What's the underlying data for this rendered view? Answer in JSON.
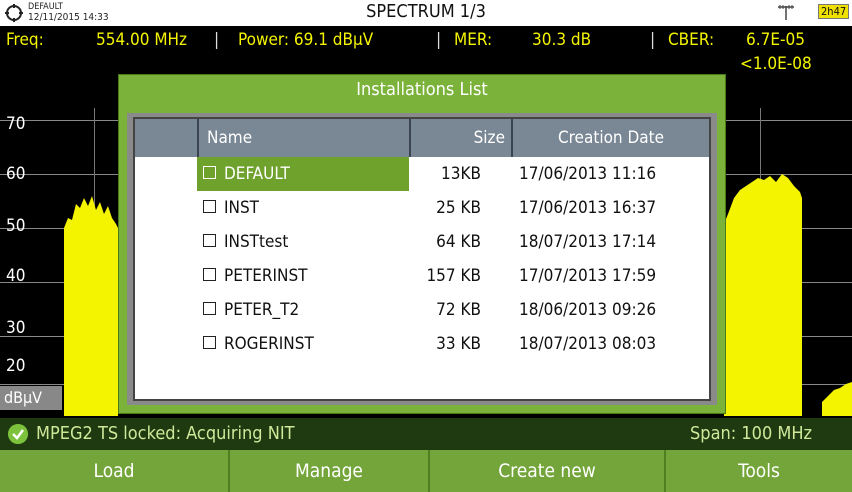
{
  "header": {
    "installation": "DEFAULT",
    "datetime": "12/11/2015 14:33",
    "title": "SPECTRUM 1/3",
    "battery": "2h47"
  },
  "measurements": {
    "freq_label": "Freq:",
    "freq_value": "554.00 MHz",
    "power": "Power: 69.1 dBµV",
    "mer_label": "MER:",
    "mer_value": "30.3 dB",
    "cber_label": "CBER:",
    "cber_value": "6.7E-05",
    "vber_value": "<1.0E-08"
  },
  "spectrum": {
    "y_ticks": [
      "70",
      "60",
      "50",
      "40",
      "30",
      "20"
    ],
    "unit": "dBµV",
    "bar_color": "#f4f400"
  },
  "dialog": {
    "title": "Installations List",
    "columns": {
      "name": "Name",
      "size": "Size",
      "date": "Creation Date"
    },
    "rows": [
      {
        "name": "DEFAULT",
        "size": "13KB",
        "date": "17/06/2013 11:16",
        "selected": true
      },
      {
        "name": "INST",
        "size": "25 KB",
        "date": "17/06/2013 16:37"
      },
      {
        "name": "INSTtest",
        "size": "64 KB",
        "date": "18/07/2013 17:14"
      },
      {
        "name": "PETERINST",
        "size": "157 KB",
        "date": "17/07/2013 17:59"
      },
      {
        "name": "PETER_T2",
        "size": "72 KB",
        "date": "18/06/2013 09:26"
      },
      {
        "name": "ROGERINST",
        "size": "33 KB",
        "date": "18/07/2013 08:03"
      }
    ]
  },
  "status": {
    "text": "MPEG2  TS locked: Acquiring NIT",
    "span": "Span: 100 MHz",
    "icon": "check-circle-icon"
  },
  "softkeys": [
    "Load",
    "Manage",
    "Create new",
    "Tools"
  ],
  "colors": {
    "accent": "#7bb23a",
    "selection": "#6fa22d",
    "header_row": "#7a8795",
    "measure_text": "#f4f400"
  }
}
